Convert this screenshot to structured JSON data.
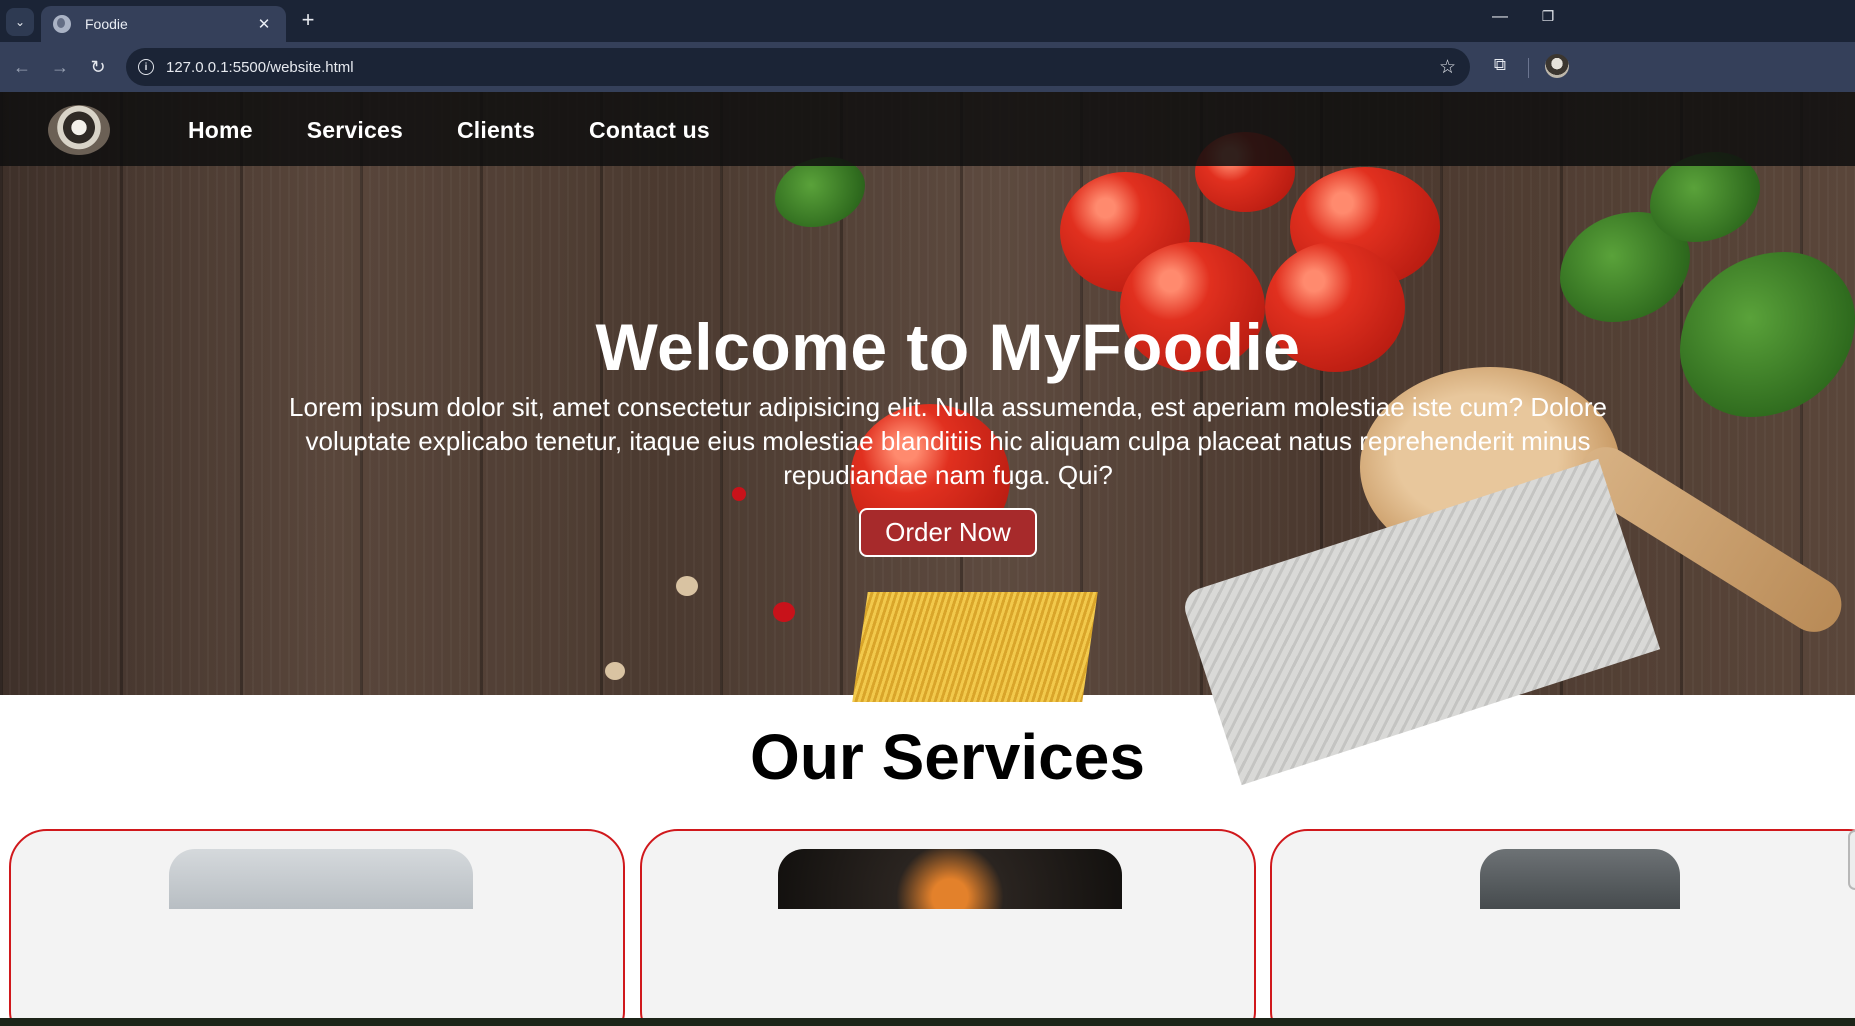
{
  "browser": {
    "tab_title": "Foodie",
    "url": "127.0.0.1:5500/website.html",
    "icons": {
      "tab_menu": "chevron-down-icon",
      "tab_favicon": "globe-icon",
      "tab_close": "close-icon",
      "new_tab": "plus-icon",
      "back": "arrow-left-icon",
      "forward": "arrow-right-icon",
      "reload": "reload-icon",
      "site_info": "info-icon",
      "bookmark": "star-icon",
      "extensions": "puzzle-icon"
    },
    "glyphs": {
      "tab_menu": "⌄",
      "tab_close": "✕",
      "new_tab": "+",
      "back": "←",
      "forward": "→",
      "reload": "↻",
      "site_info": "i",
      "bookmark": "☆",
      "extensions": "⧉",
      "minimize": "—",
      "maximize": "❐"
    }
  },
  "navbar": {
    "links": [
      "Home",
      "Services",
      "Clients",
      "Contact us"
    ]
  },
  "hero": {
    "title": "Welcome to MyFoodie",
    "text": "Lorem ipsum dolor sit, amet consectetur adipisicing elit. Nulla assumenda, est aperiam molestiae iste cum? Dolore voluptate explicabo tenetur, itaque eius molestiae blanditiis hic aliquam culpa placeat natus reprehenderit minus repudiandae nam fuga. Qui?",
    "button": "Order Now"
  },
  "services": {
    "title": "Our Services"
  },
  "colors": {
    "accent_red": "#a72a2b",
    "card_border": "#d0181c",
    "navbar_bg": "#0f0f0f",
    "browser_bg": "#1b2436"
  }
}
